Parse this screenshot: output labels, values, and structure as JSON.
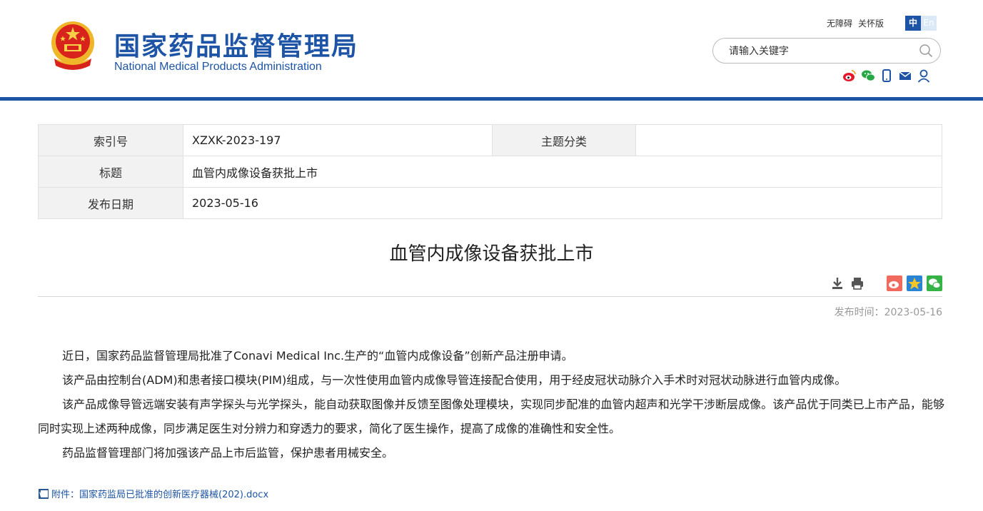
{
  "header": {
    "title": "国家药品监督管理局",
    "subtitle": "National Medical Products Administration",
    "links": [
      "无障碍",
      "关怀版"
    ],
    "lang_zh": "中",
    "lang_en": "En",
    "search_placeholder": "请输入关键字",
    "social_icons": [
      "weibo-icon",
      "wechat-icon",
      "mobile-icon",
      "mail-icon",
      "user-icon"
    ]
  },
  "meta": {
    "index_label": "索引号",
    "index_value": "XZXK-2023-197",
    "category_label": "主题分类",
    "category_value": "",
    "title_label": "标题",
    "title_value": "血管内成像设备获批上市",
    "date_label": "发布日期",
    "date_value": "2023-05-16"
  },
  "article": {
    "title": "血管内成像设备获批上市",
    "publish_time": "发布时间：2023-05-16",
    "paragraphs": [
      "近日，国家药品监督管理局批准了Conavi Medical Inc.生产的“血管内成像设备”创新产品注册申请。",
      "该产品由控制台(ADM)和患者接口模块(PIM)组成，与一次性使用血管内成像导管连接配合使用，用于经皮冠状动脉介入手术时对冠状动脉进行血管内成像。",
      "该产品成像导管远端安装有声学探头与光学探头，能自动获取图像并反馈至图像处理模块，实现同步配准的血管内超声和光学干涉断层成像。该产品优于同类已上市产品，能够同时实现上述两种成像，同步满足医生对分辨力和穿透力的要求，简化了医生操作，提高了成像的准确性和安全性。",
      "药品监督管理部门将加强该产品上市后监管，保护患者用械安全。"
    ],
    "attachment": "附件：国家药监局已批准的创新医疗器械(202).docx",
    "toolbar_icons": [
      "download-icon",
      "print-icon",
      "share-weibo-icon",
      "share-qzone-icon",
      "share-wechat-icon"
    ]
  },
  "colors": {
    "brand_blue": "#1d54a6",
    "label_bg": "#f2f2f2"
  }
}
